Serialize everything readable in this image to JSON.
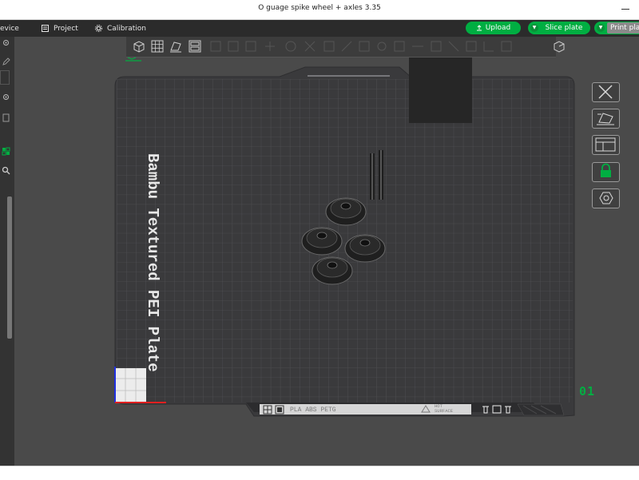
{
  "window": {
    "title": "O guage spike wheel + axles 3.35"
  },
  "tabs": [
    {
      "label": "evice"
    },
    {
      "label": "Project"
    },
    {
      "label": "Calibration"
    }
  ],
  "actions": {
    "upload": "Upload",
    "slice": "Slice plate",
    "print": "Print pla"
  },
  "plate": {
    "label": "Bambu Textured PEI Plate",
    "number": "01",
    "filament": "PLA ABS PETG",
    "hot_surface": [
      "HOT",
      "SURFACE"
    ]
  },
  "colors": {
    "accent": "#00ae42",
    "viewport": "#4a4a4a",
    "plate": "#3a3a3c",
    "toolbar": "#2b2b2b",
    "grid": "#58585c"
  }
}
